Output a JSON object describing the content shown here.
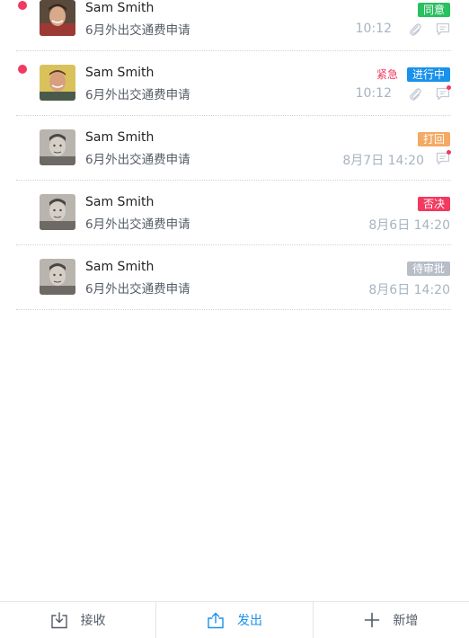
{
  "messages": [
    {
      "name": "Sam Smith",
      "subject": "6月外出交通费申请",
      "status": "同意",
      "status_color": "#29c060",
      "time": "10:12",
      "unread": true,
      "urgent": "",
      "has_attachment": true,
      "comment_unread": false,
      "avatar": "avatar-red-hoodie"
    },
    {
      "name": "Sam Smith",
      "subject": "6月外出交通费申请",
      "status": "进行中",
      "status_color": "#1a91eb",
      "time": "10:12",
      "unread": true,
      "urgent": "紧急",
      "has_attachment": true,
      "comment_unread": true,
      "avatar": "avatar-yellow-bg"
    },
    {
      "name": "Sam Smith",
      "subject": "6月外出交通费申请",
      "status": "打回",
      "status_color": "#f4a964",
      "time": "8月7日 14:20",
      "unread": false,
      "urgent": "",
      "has_attachment": false,
      "comment_unread": true,
      "avatar": "avatar-grayscale"
    },
    {
      "name": "Sam Smith",
      "subject": "6月外出交通费申请",
      "status": "否决",
      "status_color": "#f2395f",
      "time": "8月6日 14:20",
      "unread": false,
      "urgent": "",
      "has_attachment": false,
      "comment_unread": false,
      "avatar": "avatar-grayscale"
    },
    {
      "name": "Sam Smith",
      "subject": "6月外出交通费申请",
      "status": "待审批",
      "status_color": "#b8bec8",
      "time": "8月6日 14:20",
      "unread": false,
      "urgent": "",
      "has_attachment": false,
      "comment_unread": false,
      "avatar": "avatar-grayscale"
    }
  ],
  "tabbar": {
    "inbox_label": "接收",
    "sent_label": "发出",
    "new_label": "新增",
    "active": "sent",
    "active_color": "#1a91eb",
    "inbox_icon": "inbox-download-icon",
    "sent_icon": "share-upload-icon",
    "new_icon": "plus-icon"
  },
  "colors": {
    "unread_dot": "#f2395f",
    "time_text": "#a8b3c2",
    "icon_gray": "#c3cad4"
  }
}
